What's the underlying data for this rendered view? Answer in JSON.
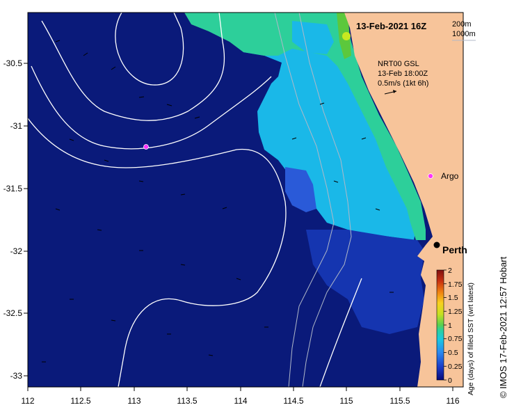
{
  "map": {
    "date_title": "13-Feb-2021 16Z",
    "depth_contours": [
      "200m",
      "1000m"
    ],
    "current_info": [
      "NRT00 GSL",
      "13-Feb 18:00Z",
      "0.5m/s (1kt 6h)"
    ],
    "argo_label": "Argo",
    "city_label": "Perth",
    "x_ticks": [
      "112",
      "112.5",
      "113",
      "113.5",
      "114",
      "114.5",
      "115",
      "115.5",
      "116"
    ],
    "y_ticks": [
      "-30.5",
      "-31",
      "-31.5",
      "-32",
      "-32.5",
      "-33"
    ],
    "credit": "© IMOS 17-Feb-2021 12:57 Hobart",
    "colors": {
      "ocean_deep": "#0a1a7a",
      "ocean_mid": "#1535b0",
      "cyan": "#1ab8e8",
      "light_blue": "#3aa8f0",
      "teal": "#2dcf9a",
      "green": "#6fd24a",
      "land": "#f7c49a",
      "argo": "#ff33ff"
    }
  },
  "legend": {
    "title": "Age (days) of filled SST (wrt latest)",
    "ticks": [
      "2",
      "1.75",
      "1.5",
      "1.25",
      "1",
      "0.75",
      "0.5",
      "0.25",
      "0"
    ]
  }
}
